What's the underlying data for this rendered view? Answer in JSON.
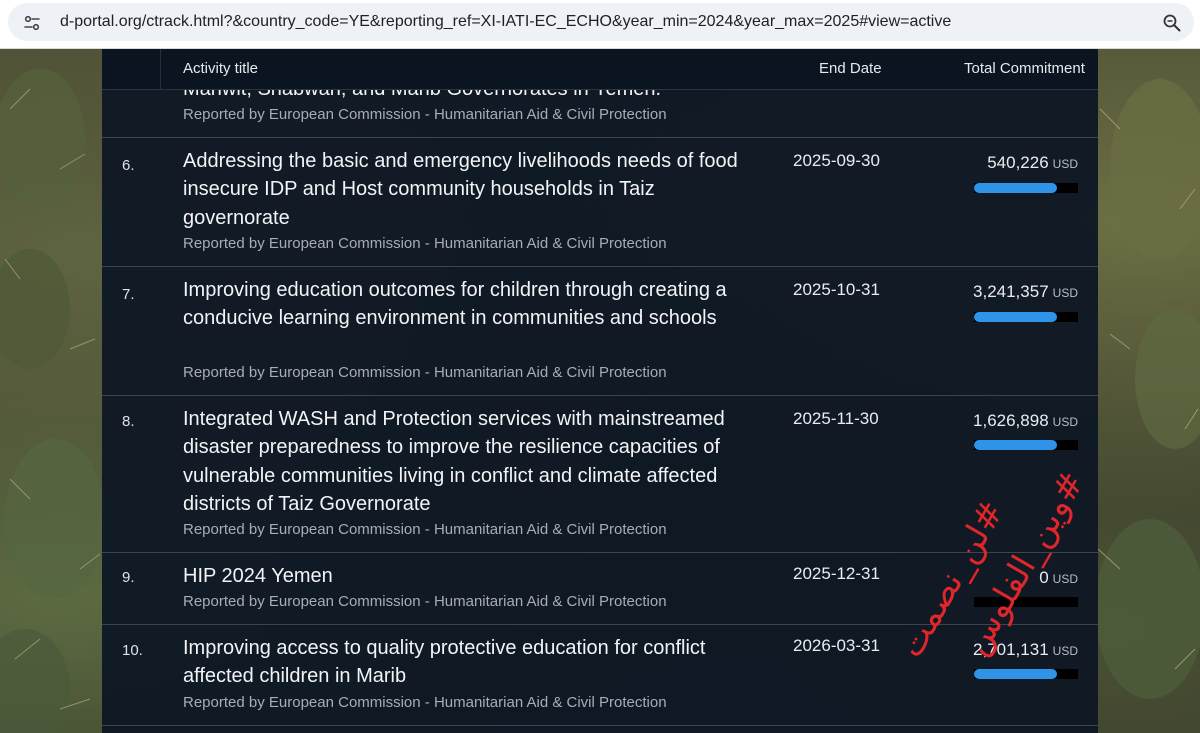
{
  "browser": {
    "url": "d-portal.org/ctrack.html?&country_code=YE&reporting_ref=XI-IATI-EC_ECHO&year_min=2024&year_max=2025#view=active"
  },
  "table": {
    "headers": {
      "title": "Activity title",
      "end_date": "End Date",
      "total": "Total Commitment"
    },
    "partial_row": {
      "title_tail": "Mahwit, Shabwah, and Marib Governorates in Yemen.",
      "reporter": "Reported by European Commission - Humanitarian Aid & Civil Protection"
    },
    "rows": [
      {
        "num": "6.",
        "title": "Addressing the basic and emergency livelihoods needs of food insecure IDP and Host community households in Taiz governorate",
        "reporter": "Reported by European Commission - Humanitarian Aid & Civil Protection",
        "end_date": "2025-09-30",
        "amount": "540,226",
        "currency": "USD",
        "bar_fraction": 0.8
      },
      {
        "num": "7.",
        "title": "Improving education outcomes for children through creating a conducive learning environment in communities and schools",
        "reporter": "Reported by European Commission - Humanitarian Aid & Civil Protection",
        "end_date": "2025-10-31",
        "amount": "3,241,357",
        "currency": "USD",
        "bar_fraction": 0.8
      },
      {
        "num": "8.",
        "title": "Integrated WASH and Protection services with mainstreamed disaster preparedness to improve the resilience capacities of vulnerable communities living in conflict and climate affected districts of Taiz Governorate",
        "reporter": "Reported by European Commission - Humanitarian Aid & Civil Protection",
        "end_date": "2025-11-30",
        "amount": "1,626,898",
        "currency": "USD",
        "bar_fraction": 0.8
      },
      {
        "num": "9.",
        "title": "HIP 2024 Yemen",
        "reporter": "Reported by European Commission - Humanitarian Aid & Civil Protection",
        "end_date": "2025-12-31",
        "amount": "0",
        "currency": "USD",
        "bar_fraction": 0
      },
      {
        "num": "10.",
        "title": "Improving access to quality protective education for conflict affected children in Marib",
        "reporter": "Reported by European Commission - Humanitarian Aid & Civil Protection",
        "end_date": "2026-03-31",
        "amount": "2,701,131",
        "currency": "USD",
        "bar_fraction": 0.8
      }
    ]
  },
  "overlay": {
    "line1": "#لن_نصمت",
    "line2": "#وين_الفلوس",
    "color": "#e0262a"
  },
  "colors": {
    "bar_fill": "#2f94e8",
    "bar_track": "#000000",
    "panel_bg": "#0c1624"
  }
}
